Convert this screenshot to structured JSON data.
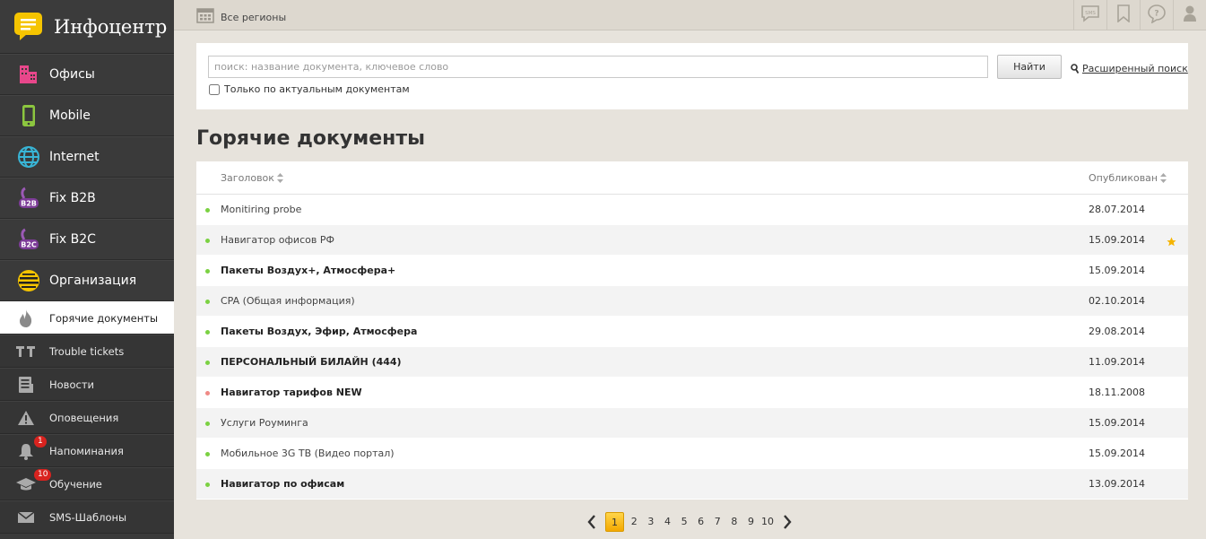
{
  "app": {
    "title": "Инфоцентр"
  },
  "sidebar": {
    "main_items": [
      {
        "label": "Офисы",
        "icon": "buildings-icon"
      },
      {
        "label": "Mobile",
        "icon": "mobile-phone-icon"
      },
      {
        "label": "Internet",
        "icon": "globe-icon"
      },
      {
        "label": "Fix B2B",
        "icon": "b2b-phone-icon"
      },
      {
        "label": "Fix B2C",
        "icon": "b2c-phone-icon"
      },
      {
        "label": "Организация",
        "icon": "beeline-logo-icon"
      }
    ],
    "sub_items": [
      {
        "label": "Горячие документы",
        "icon": "flame-icon",
        "active": true
      },
      {
        "label": "Trouble tickets",
        "icon": "tt-icon"
      },
      {
        "label": "Новости",
        "icon": "newspaper-icon"
      },
      {
        "label": "Оповещения",
        "icon": "warning-icon"
      },
      {
        "label": "Напоминания",
        "icon": "bell-icon",
        "badge": "1"
      },
      {
        "label": "Обучение",
        "icon": "graduation-cap-icon",
        "badge": "10"
      },
      {
        "label": "SMS-Шаблоны",
        "icon": "envelope-icon"
      }
    ]
  },
  "topbar": {
    "region_label": "Все регионы",
    "buttons": [
      "sms-icon",
      "bookmark-icon",
      "help-icon",
      "user-icon"
    ]
  },
  "search": {
    "placeholder": "поиск: название документа, ключевое слово",
    "value": "",
    "button_label": "Найти",
    "advanced_label": "Расширенный поиск",
    "only_actual_label": "Только по актуальным документам",
    "only_actual_checked": false
  },
  "page_title": "Горячие документы",
  "table": {
    "col_title": "Заголовок",
    "col_published": "Опубликован",
    "rows": [
      {
        "title": "Monitiring probe",
        "date": "28.07.2014",
        "bold": false,
        "status": "green",
        "star": false
      },
      {
        "title": "Навигатор офисов РФ",
        "date": "15.09.2014",
        "bold": false,
        "status": "green",
        "star": true
      },
      {
        "title": "Пакеты Воздух+, Атмосфера+",
        "date": "15.09.2014",
        "bold": true,
        "status": "green",
        "star": false
      },
      {
        "title": "CPA (Общая информация)",
        "date": "02.10.2014",
        "bold": false,
        "status": "green",
        "star": false
      },
      {
        "title": "Пакеты Воздух, Эфир, Атмосфера",
        "date": "29.08.2014",
        "bold": true,
        "status": "green",
        "star": false
      },
      {
        "title": "ПЕРСОНАЛЬНЫЙ БИЛАЙН (444)",
        "date": "11.09.2014",
        "bold": true,
        "status": "green",
        "star": false
      },
      {
        "title": "Навигатор тарифов NEW",
        "date": "18.11.2008",
        "bold": true,
        "status": "red",
        "star": false
      },
      {
        "title": "Услуги Роуминга",
        "date": "15.09.2014",
        "bold": false,
        "status": "green",
        "star": false
      },
      {
        "title": "Мобильное 3G ТВ (Видео портал)",
        "date": "15.09.2014",
        "bold": false,
        "status": "green",
        "star": false
      },
      {
        "title": "Навигатор по офисам",
        "date": "13.09.2014",
        "bold": true,
        "status": "green",
        "star": false
      }
    ]
  },
  "pagination": {
    "pages": [
      "1",
      "2",
      "3",
      "4",
      "5",
      "6",
      "7",
      "8",
      "9",
      "10"
    ],
    "current": "1"
  },
  "colors": {
    "accent": "#f4a800",
    "sidebar_bg": "#3a3a3a",
    "status_green": "#7bd142",
    "status_red": "#f08a86"
  }
}
